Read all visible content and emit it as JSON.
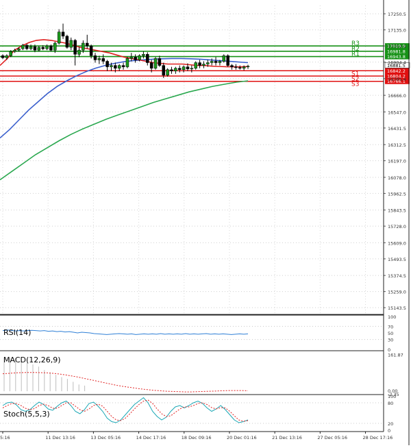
{
  "chart_data": {
    "type": "line",
    "main": {
      "type": "candlestick",
      "ylim": [
        15100,
        17310
      ],
      "price_ticks": [
        "17250.5",
        "17135.0",
        "17019.9",
        "16904.4",
        "16785.4",
        "16666.0",
        "16547.0",
        "16431.5",
        "16312.5",
        "16197.0",
        "16078.0",
        "15962.5",
        "15843.5",
        "15728.0",
        "15609.0",
        "15493.5",
        "15374.5",
        "15259.0",
        "15143.5"
      ],
      "levels": [
        {
          "name": "R3",
          "value": 17019.9,
          "label": "17019.9",
          "color": "#169116",
          "label_bg": "#169116"
        },
        {
          "name": "R2",
          "value": 16981.8,
          "label": "16981.8",
          "color": "#169116",
          "label_bg": "#169116"
        },
        {
          "name": "R1",
          "value": 16943.8,
          "label": "16943.8",
          "color": "#169116",
          "label_bg": "#169116"
        },
        {
          "name": "S1",
          "value": 16842.2,
          "label": "16842.2",
          "color": "#e01010",
          "label_bg": "#e01010"
        },
        {
          "name": "S2",
          "value": 16804.2,
          "label": "16804.2",
          "color": "#e01010",
          "label_bg": "#e01010"
        },
        {
          "name": "S3",
          "value": 16766.1,
          "label": "16766.1",
          "color": "#e01010",
          "label_bg": "#e01010"
        }
      ],
      "current_price": "16881.5",
      "candles": [
        [
          16950,
          16960,
          16925,
          16935
        ],
        [
          16935,
          16960,
          16920,
          16950
        ],
        [
          16950,
          16990,
          16940,
          16980
        ],
        [
          16980,
          17000,
          16970,
          16990
        ],
        [
          16990,
          17010,
          16980,
          17000
        ],
        [
          17000,
          17035,
          16990,
          17025
        ],
        [
          17025,
          17035,
          16990,
          17000
        ],
        [
          17000,
          17030,
          16990,
          17015
        ],
        [
          17015,
          17030,
          16975,
          16990
        ],
        [
          16990,
          17020,
          16980,
          17010
        ],
        [
          17010,
          17025,
          16990,
          17000
        ],
        [
          17000,
          17030,
          16990,
          17020
        ],
        [
          17020,
          17030,
          16980,
          16990
        ],
        [
          16990,
          17050,
          16970,
          17040
        ],
        [
          17040,
          17140,
          17030,
          17120
        ],
        [
          17120,
          17180,
          17070,
          17090
        ],
        [
          17090,
          17100,
          17000,
          17010
        ],
        [
          17010,
          17080,
          16990,
          17060
        ],
        [
          17060,
          17070,
          16880,
          16960
        ],
        [
          16960,
          17010,
          16940,
          16990
        ],
        [
          16990,
          17060,
          16970,
          17040
        ],
        [
          17040,
          17100,
          17000,
          17020
        ],
        [
          17020,
          17030,
          16930,
          16950
        ],
        [
          16950,
          16970,
          16900,
          16920
        ],
        [
          16920,
          16950,
          16890,
          16930
        ],
        [
          16930,
          16960,
          16890,
          16910
        ],
        [
          16910,
          16920,
          16840,
          16870
        ],
        [
          16870,
          16900,
          16840,
          16880
        ],
        [
          16880,
          16900,
          16830,
          16860
        ],
        [
          16860,
          16890,
          16840,
          16880
        ],
        [
          16880,
          16900,
          16850,
          16870
        ],
        [
          16870,
          16940,
          16860,
          16930
        ],
        [
          16930,
          16970,
          16910,
          16940
        ],
        [
          16940,
          16960,
          16900,
          16920
        ],
        [
          16920,
          16960,
          16910,
          16950
        ],
        [
          16950,
          16980,
          16930,
          16960
        ],
        [
          16960,
          16975,
          16880,
          16900
        ],
        [
          16900,
          16920,
          16830,
          16860
        ],
        [
          16860,
          16940,
          16850,
          16930
        ],
        [
          16930,
          16950,
          16870,
          16880
        ],
        [
          16880,
          16900,
          16790,
          16810
        ],
        [
          16810,
          16860,
          16800,
          16850
        ],
        [
          16850,
          16870,
          16820,
          16840
        ],
        [
          16840,
          16870,
          16820,
          16860
        ],
        [
          16860,
          16880,
          16830,
          16850
        ],
        [
          16850,
          16880,
          16830,
          16870
        ],
        [
          16870,
          16895,
          16840,
          16855
        ],
        [
          16855,
          16880,
          16830,
          16860
        ],
        [
          16860,
          16910,
          16850,
          16900
        ],
        [
          16900,
          16920,
          16860,
          16880
        ],
        [
          16880,
          16910,
          16860,
          16890
        ],
        [
          16890,
          16920,
          16870,
          16900
        ],
        [
          16900,
          16930,
          16880,
          16910
        ],
        [
          16910,
          16940,
          16880,
          16900
        ],
        [
          16900,
          16920,
          16880,
          16910
        ],
        [
          16910,
          16960,
          16900,
          16950
        ],
        [
          16950,
          16960,
          16870,
          16880
        ],
        [
          16880,
          16890,
          16850,
          16870
        ],
        [
          16870,
          16890,
          16850,
          16865
        ],
        [
          16865,
          16880,
          16850,
          16860
        ],
        [
          16860,
          16880,
          16845,
          16870
        ],
        [
          16870,
          16885,
          16855,
          16875
        ]
      ],
      "ma_fast": [
        16880,
        16930,
        16990,
        17020,
        17045,
        17060,
        17065,
        17060,
        17050,
        17040,
        17025,
        17010,
        17000,
        16990,
        16980,
        16970,
        16955,
        16940,
        16930,
        16920,
        16910,
        16900,
        16895,
        16890,
        16890,
        16890,
        16885,
        16880,
        16880,
        16875,
        16873,
        16871,
        16870,
        16870,
        16872
      ],
      "ma_mid": [
        16360,
        16420,
        16490,
        16560,
        16620,
        16680,
        16730,
        16770,
        16805,
        16835,
        16860,
        16880,
        16895,
        16907,
        16915,
        16920,
        16925,
        16928,
        16930,
        16930,
        16928,
        16925,
        16920,
        16915,
        16910,
        16905,
        16900
      ],
      "ma_slow": [
        16060,
        16120,
        16180,
        16240,
        16290,
        16340,
        16385,
        16425,
        16460,
        16495,
        16525,
        16555,
        16585,
        16615,
        16640,
        16665,
        16690,
        16710,
        16730,
        16745,
        16760,
        16770
      ],
      "x_ticks": [
        "5:16",
        "11 Dec 13:16",
        "13 Dec 05:16",
        "14 Dec 17:16",
        "18 Dec 09:16",
        "20 Dec 01:16",
        "21 Dec 13:16",
        "27 Dec 05:16",
        "28 Dec 17:16"
      ]
    },
    "rsi": {
      "label": "RSI(14)",
      "ylim": [
        0,
        100
      ],
      "ticks": [
        "100",
        "70",
        "50",
        "30",
        "0"
      ],
      "values": [
        57,
        59,
        58,
        56,
        57,
        56,
        57,
        58,
        57,
        56,
        57,
        55,
        56,
        54,
        55,
        53,
        54,
        52,
        50,
        52,
        51,
        50,
        48,
        47,
        46,
        45,
        46,
        47,
        48,
        47,
        46,
        47,
        45,
        46,
        47,
        46,
        47,
        46,
        48,
        46,
        47,
        46,
        47,
        46,
        48,
        46,
        47,
        46,
        47,
        48,
        46,
        47,
        46,
        47,
        46,
        45,
        46,
        47,
        46,
        47
      ]
    },
    "macd": {
      "label": "MACD(12,26,9)",
      "ticks": [
        "161.87",
        "0.00",
        "-2.35"
      ],
      "ylim": [
        -12,
        175
      ],
      "histogram": [
        152,
        150,
        148,
        140,
        128,
        120,
        110,
        95,
        85,
        73,
        63,
        55,
        42,
        30,
        25
      ],
      "signal": [
        78,
        80,
        82,
        83,
        84,
        84,
        83,
        82,
        80,
        77,
        73,
        68,
        63,
        57,
        51,
        45,
        39,
        33,
        27,
        22,
        18,
        14,
        10,
        7,
        4,
        2,
        0,
        -1,
        -2,
        -3,
        -3,
        -2,
        -1,
        0,
        1,
        2,
        3,
        3,
        3,
        2
      ]
    },
    "stoch": {
      "label": "Stoch(5,5,3)",
      "ylim": [
        0,
        100
      ],
      "ticks": [
        "100",
        "80",
        "20",
        "0"
      ],
      "k": [
        72,
        80,
        82,
        74,
        60,
        55,
        60,
        72,
        82,
        75,
        62,
        58,
        70,
        80,
        85,
        72,
        55,
        48,
        60,
        78,
        82,
        70,
        55,
        35,
        25,
        22,
        30,
        45,
        60,
        75,
        85,
        95,
        80,
        55,
        40,
        30,
        38,
        55,
        68,
        72,
        65,
        72,
        80,
        85,
        78,
        65,
        55,
        62,
        72,
        60,
        45,
        30,
        22,
        25,
        30
      ],
      "d": [
        65,
        72,
        78,
        78,
        72,
        64,
        60,
        63,
        72,
        76,
        72,
        64,
        64,
        72,
        80,
        80,
        70,
        60,
        55,
        62,
        72,
        76,
        70,
        55,
        40,
        30,
        28,
        35,
        48,
        62,
        75,
        85,
        88,
        78,
        62,
        48,
        40,
        42,
        52,
        62,
        68,
        68,
        72,
        78,
        80,
        75,
        66,
        62,
        66,
        65,
        55,
        42,
        30,
        26,
        28
      ]
    }
  }
}
